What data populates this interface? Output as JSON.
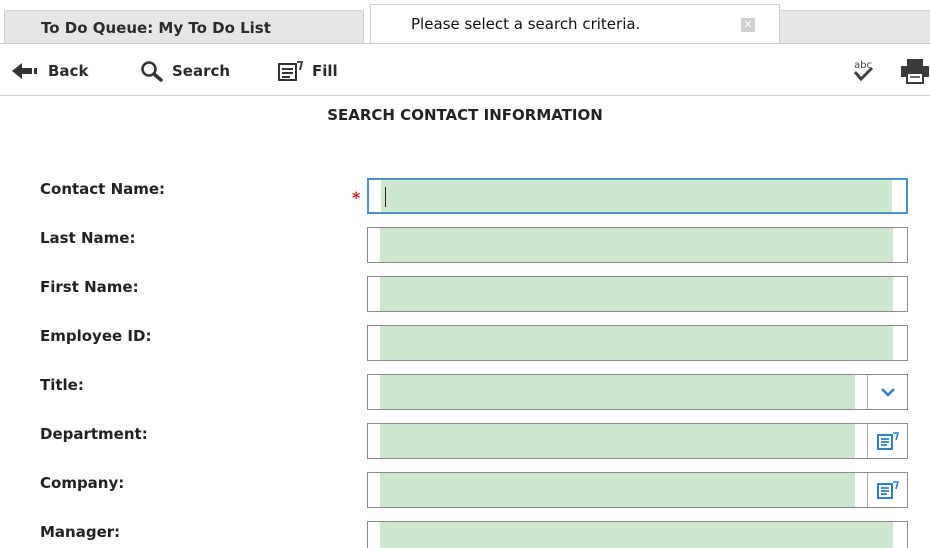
{
  "tabs": {
    "inactive_label": "To Do Queue: My To Do List",
    "active_label": "Please select a search criteria.",
    "close_glyph": "✕"
  },
  "toolbar": {
    "back_label": "Back",
    "search_label": "Search",
    "fill_label": "Fill",
    "back_icon": "back-arrow-icon",
    "search_icon": "magnifier-icon",
    "fill_icon": "fill-form-icon",
    "spell_icon": "spell-check-icon",
    "print_icon": "printer-icon"
  },
  "form": {
    "heading": "SEARCH CONTACT INFORMATION",
    "required_marker": "*",
    "fields": [
      {
        "label": "Contact Name:",
        "value": "",
        "required": true,
        "focused": true,
        "control": "text"
      },
      {
        "label": "Last Name:",
        "value": "",
        "control": "text"
      },
      {
        "label": "First Name:",
        "value": "",
        "control": "text"
      },
      {
        "label": "Employee ID:",
        "value": "",
        "control": "text"
      },
      {
        "label": "Title:",
        "value": "",
        "control": "dropdown"
      },
      {
        "label": "Department:",
        "value": "",
        "control": "lookup"
      },
      {
        "label": "Company:",
        "value": "",
        "control": "lookup"
      },
      {
        "label": "Manager:",
        "value": "",
        "control": "text"
      }
    ]
  },
  "colors": {
    "field_fill": "#cde8cf",
    "focus_border": "#4a90d9",
    "required": "#e02020",
    "icon_blue": "#2f7fc8"
  }
}
